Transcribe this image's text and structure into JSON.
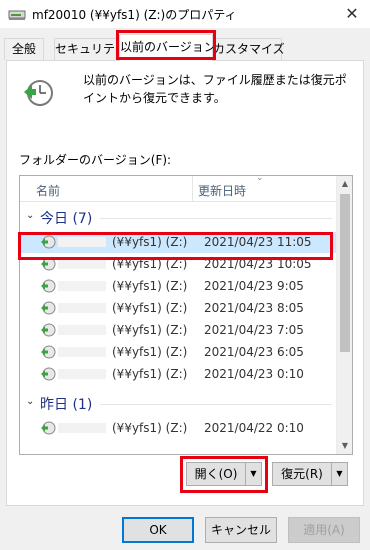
{
  "window": {
    "title": "mf20010 (¥¥yfs1) (Z:)のプロパティ",
    "close_glyph": "✕"
  },
  "tabs": [
    {
      "label": "全般",
      "active": false
    },
    {
      "label": "セキュリティ",
      "active": false
    },
    {
      "label": "以前のバージョン",
      "active": true
    },
    {
      "label": "カスタマイズ",
      "active": false
    }
  ],
  "info": {
    "text": "以前のバージョンは、ファイル履歴または復元ポイントから復元できます。"
  },
  "folder_versions_label": "フォルダーのバージョン(F):",
  "list": {
    "columns": {
      "name": "名前",
      "date": "更新日時"
    },
    "groups": [
      {
        "label": "今日 (7)",
        "rows": [
          {
            "name": "(¥¥yfs1) (Z:)",
            "date": "2021/04/23 11:05",
            "selected": true
          },
          {
            "name": "(¥¥yfs1) (Z:)",
            "date": "2021/04/23 10:05",
            "selected": false
          },
          {
            "name": "(¥¥yfs1) (Z:)",
            "date": "2021/04/23 9:05",
            "selected": false
          },
          {
            "name": "(¥¥yfs1) (Z:)",
            "date": "2021/04/23 8:05",
            "selected": false
          },
          {
            "name": "(¥¥yfs1) (Z:)",
            "date": "2021/04/23 7:05",
            "selected": false
          },
          {
            "name": "(¥¥yfs1) (Z:)",
            "date": "2021/04/23 6:05",
            "selected": false
          },
          {
            "name": "(¥¥yfs1) (Z:)",
            "date": "2021/04/23 0:10",
            "selected": false
          }
        ]
      },
      {
        "label": "昨日 (1)",
        "rows": [
          {
            "name": "(¥¥yfs1) (Z:)",
            "date": "2021/04/22 0:10",
            "selected": false
          }
        ]
      }
    ]
  },
  "actions": {
    "open_label": "開く(O)",
    "restore_label": "復元(R)"
  },
  "dialog_buttons": {
    "ok": "OK",
    "cancel": "キャンセル",
    "apply": "適用(A)"
  },
  "colors": {
    "highlight_box": "#e60012",
    "selected_row": "#cce8ff",
    "group_header_text": "#1e3287",
    "default_button_border": "#0078d7"
  },
  "icons": {
    "title": "drive-icon",
    "info": "clock-restore-icon",
    "row": "previous-version-icon"
  }
}
